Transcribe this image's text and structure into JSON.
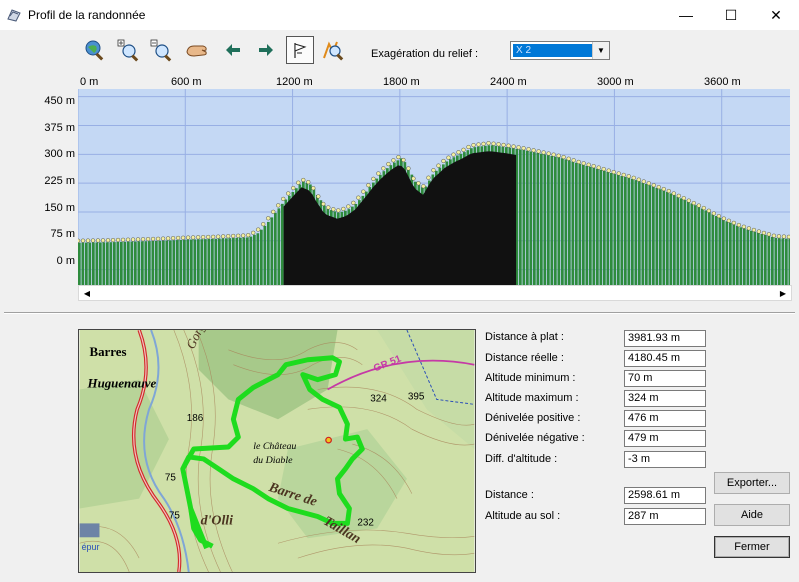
{
  "window": {
    "title": "Profil de la randonnée",
    "minimize": "—",
    "maximize": "☐",
    "close": "✕"
  },
  "toolbar": {
    "tools": [
      "zoom-globe-icon",
      "zoom-in-icon",
      "zoom-out-icon",
      "pan-hand-icon",
      "arrow-left-icon",
      "arrow-right-icon",
      "flag-icon",
      "zoom-route-icon"
    ],
    "exaggeration_label": "Exagération du relief :",
    "exaggeration_value": "X 2"
  },
  "chart_data": {
    "type": "area",
    "xlabel": "",
    "ylabel": "",
    "x_ticks": [
      "0 m",
      "600 m",
      "1200 m",
      "1800 m",
      "2400 m",
      "3000 m",
      "3600 m"
    ],
    "y_ticks": [
      "450 m",
      "375 m",
      "300 m",
      "225 m",
      "150 m",
      "75 m",
      "0 m"
    ],
    "xlim": [
      0,
      3981.93
    ],
    "ylim": [
      -40,
      470
    ],
    "grid": true,
    "colors": {
      "background": "#c4d8f4",
      "grid": "#98afe4",
      "fill_light": "#2e8b3d",
      "fill_dark": "#111111",
      "points": "#f4f0a0"
    },
    "series": [
      {
        "x": [
          0,
          150,
          300,
          450,
          600,
          750,
          850,
          950,
          1000,
          1050,
          1100,
          1150,
          1200,
          1250,
          1300,
          1330,
          1380,
          1450,
          1500,
          1550,
          1600,
          1650,
          1700,
          1750,
          1800,
          1830,
          1880,
          1930,
          1980,
          2050,
          2100,
          2150,
          2200,
          2300,
          2400,
          2500,
          2600,
          2700,
          2800,
          2900,
          3000,
          3100,
          3200,
          3300,
          3400,
          3500,
          3600,
          3700,
          3800,
          3900,
          3981.93
        ],
        "y": [
          70,
          71,
          73,
          75,
          78,
          80,
          82,
          84,
          95,
          120,
          150,
          180,
          205,
          230,
          220,
          195,
          160,
          148,
          155,
          172,
          200,
          230,
          255,
          275,
          290,
          275,
          228,
          210,
          250,
          280,
          294,
          305,
          318,
          324,
          318,
          310,
          300,
          290,
          275,
          262,
          248,
          235,
          218,
          200,
          178,
          155,
          130,
          110,
          95,
          82,
          80
        ]
      }
    ]
  },
  "stats": [
    {
      "label": "Distance à plat :",
      "value": "3981.93 m"
    },
    {
      "label": "Distance réelle :",
      "value": "4180.45 m"
    },
    {
      "label": "Altitude minimum :",
      "value": "70 m"
    },
    {
      "label": "Altitude maximum :",
      "value": "324 m"
    },
    {
      "label": "Dénivelée positive :",
      "value": "476 m"
    },
    {
      "label": "Dénivelée négative :",
      "value": "479 m"
    },
    {
      "label": "Diff. d'altitude :",
      "value": "-3 m"
    },
    {
      "label": "Distance :",
      "value": "2598.61 m"
    },
    {
      "label": "Altitude au sol :",
      "value": "287 m"
    }
  ],
  "buttons": {
    "export": "Exporter...",
    "help": "Aide",
    "close": "Fermer"
  },
  "map": {
    "labels": {
      "barres": "Barres",
      "huguenauve": "Huguenauve",
      "chateau_1": "le Château",
      "chateau_2": "du Diable",
      "barre_de": "Barre de",
      "d_olli": "d'Olli",
      "taillan": "Taillan",
      "gr": "GR 51",
      "n324": "324",
      "n395": "395",
      "n186": "186",
      "n75a": "75",
      "n75b": "75",
      "n232": "232",
      "gorges": "Gorges",
      "epur": "épur"
    },
    "colors": {
      "land": "#cfe0a8",
      "forest": "#a7c98a",
      "contour": "#a8845a",
      "road": "#d22a2a",
      "track": "#1edc1e",
      "river": "#7fa6d6"
    }
  }
}
